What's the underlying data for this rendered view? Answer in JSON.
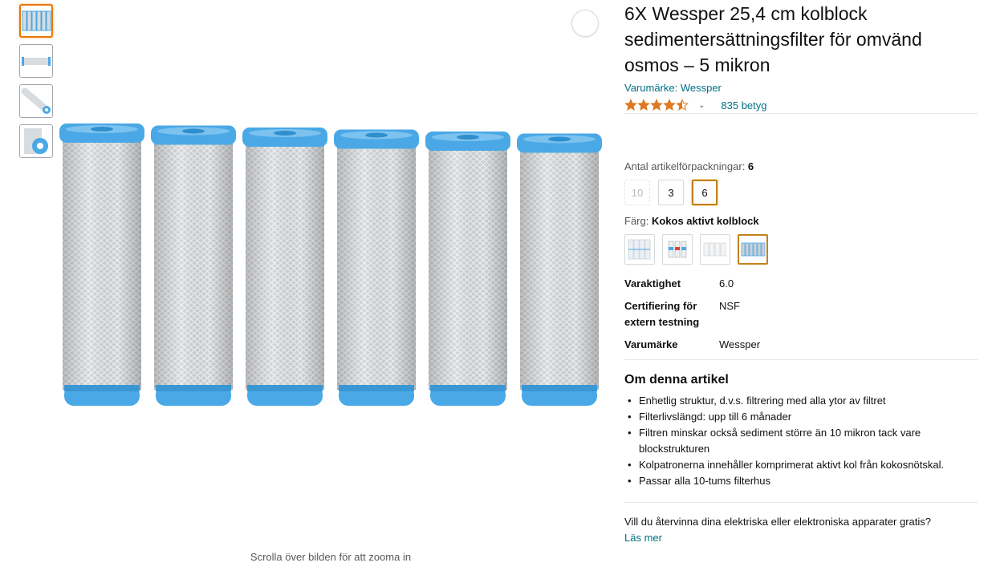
{
  "gallery": {
    "thumbnails": [
      {
        "icon": "filter-row-thumbnail",
        "selected": true
      },
      {
        "icon": "filter-side-thumbnail",
        "selected": false
      },
      {
        "icon": "filter-diagonal-thumbnail",
        "selected": false
      },
      {
        "icon": "filter-closeup-thumbnail",
        "selected": false
      }
    ],
    "main_image_icon": "six-filter-cartridges-image",
    "zoom_hint": "Scrolla över bilden för att zooma in",
    "share_icon": "share-icon"
  },
  "product": {
    "title": "6X Wessper 25,4 cm kolblock sedimentersättningsfilter för omvänd osmos – 5 mikron",
    "brand_link": "Varumärke: Wessper",
    "rating": {
      "stars": 4.5,
      "count_text": "835 betyg"
    }
  },
  "variations": {
    "pack": {
      "label": "Antal artikelförpackningar: ",
      "selected_value": "6",
      "options": [
        {
          "label": "10",
          "state": "disabled"
        },
        {
          "label": "3",
          "state": "normal"
        },
        {
          "label": "6",
          "state": "selected"
        }
      ]
    },
    "color": {
      "label": "Färg: ",
      "selected_value": "Kokos aktivt kolblock",
      "swatches": [
        {
          "icon": "white-filters-swatch",
          "selected": false
        },
        {
          "icon": "three-filters-swatch",
          "selected": false
        },
        {
          "icon": "sediment-filters-swatch",
          "selected": false
        },
        {
          "icon": "carbon-block-filters-swatch",
          "selected": true
        }
      ]
    }
  },
  "specs": [
    {
      "key": "Varaktighet",
      "value": "6.0"
    },
    {
      "key": "Certifiering för extern testning",
      "value": "NSF"
    },
    {
      "key": "Varumärke",
      "value": "Wessper"
    }
  ],
  "about": {
    "title": "Om denna artikel",
    "bullets": [
      "Enhetlig struktur, d.v.s. filtrering med alla ytor av filtret",
      "Filterlivslängd: upp till 6 månader",
      "Filtren minskar också sediment större än 10 mikron tack vare blockstrukturen",
      "Kolpatronerna innehåller komprimerat aktivt kol från kokosnötskal.",
      "Passar alla 10-tums filterhus"
    ]
  },
  "recycle": {
    "text": "Vill du återvinna dina elektriska eller elektroniska apparater gratis?",
    "link": "Läs mer"
  },
  "colors": {
    "link": "#007185",
    "star": "#de7921",
    "filter_cap": "#4aa8e6",
    "selected_border": "#c2821d"
  }
}
